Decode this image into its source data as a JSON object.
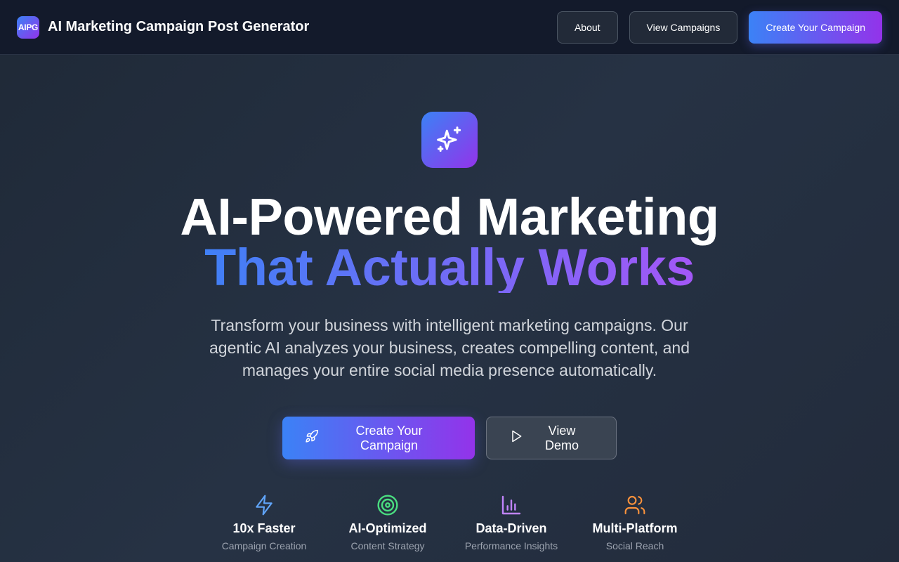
{
  "header": {
    "logo_text": "AIPG",
    "title": "AI Marketing Campaign Post Generator",
    "nav": {
      "about": "About",
      "view_campaigns": "View Campaigns",
      "create_campaign": "Create Your Campaign"
    }
  },
  "hero": {
    "icon": "sparkles-icon",
    "headline_line1": "AI-Powered Marketing",
    "headline_line2": "That Actually Works",
    "subtitle": "Transform your business with intelligent marketing campaigns. Our agentic AI analyzes your business, creates compelling content, and manages your entire social media presence automatically.",
    "cta_primary": "Create Your Campaign",
    "cta_primary_icon": "rocket-icon",
    "cta_secondary": "View Demo",
    "cta_secondary_icon": "play-icon"
  },
  "features": [
    {
      "icon": "lightning-icon",
      "title": "10x Faster",
      "subtitle": "Campaign Creation",
      "color": "#60a5fa"
    },
    {
      "icon": "target-icon",
      "title": "AI-Optimized",
      "subtitle": "Content Strategy",
      "color": "#4ade80"
    },
    {
      "icon": "bar-chart-icon",
      "title": "Data-Driven",
      "subtitle": "Performance Insights",
      "color": "#c084fc"
    },
    {
      "icon": "users-icon",
      "title": "Multi-Platform",
      "subtitle": "Social Reach",
      "color": "#fb923c"
    }
  ],
  "colors": {
    "accent_start": "#3b82f6",
    "accent_end": "#9333ea",
    "background": "#1f2937",
    "header_background": "#131a2b"
  }
}
